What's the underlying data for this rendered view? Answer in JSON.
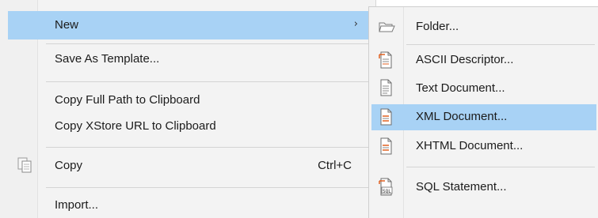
{
  "main_menu": {
    "items": [
      {
        "label": "New",
        "has_submenu": true,
        "highlighted": true
      },
      {
        "label": "Save As Template..."
      },
      {
        "label": "Copy Full Path to Clipboard"
      },
      {
        "label": "Copy XStore URL to Clipboard"
      },
      {
        "label": "Copy",
        "shortcut": "Ctrl+C",
        "icon": "copy-icon"
      },
      {
        "label": "Import..."
      }
    ]
  },
  "submenu": {
    "items": [
      {
        "label": "Folder...",
        "icon": "folder-icon"
      },
      {
        "label": "ASCII Descriptor...",
        "icon": "ascii-descriptor-icon"
      },
      {
        "label": "Text Document...",
        "icon": "text-document-icon"
      },
      {
        "label": "XML Document...",
        "icon": "xml-document-icon",
        "highlighted": true
      },
      {
        "label": "XHTML Document...",
        "icon": "xhtml-document-icon"
      },
      {
        "label": "SQL Statement...",
        "icon": "sql-statement-icon"
      }
    ]
  },
  "colors": {
    "highlight": "#a8d2f5",
    "menu_bg": "#f3f3f3",
    "separator": "#d4d4d4"
  }
}
